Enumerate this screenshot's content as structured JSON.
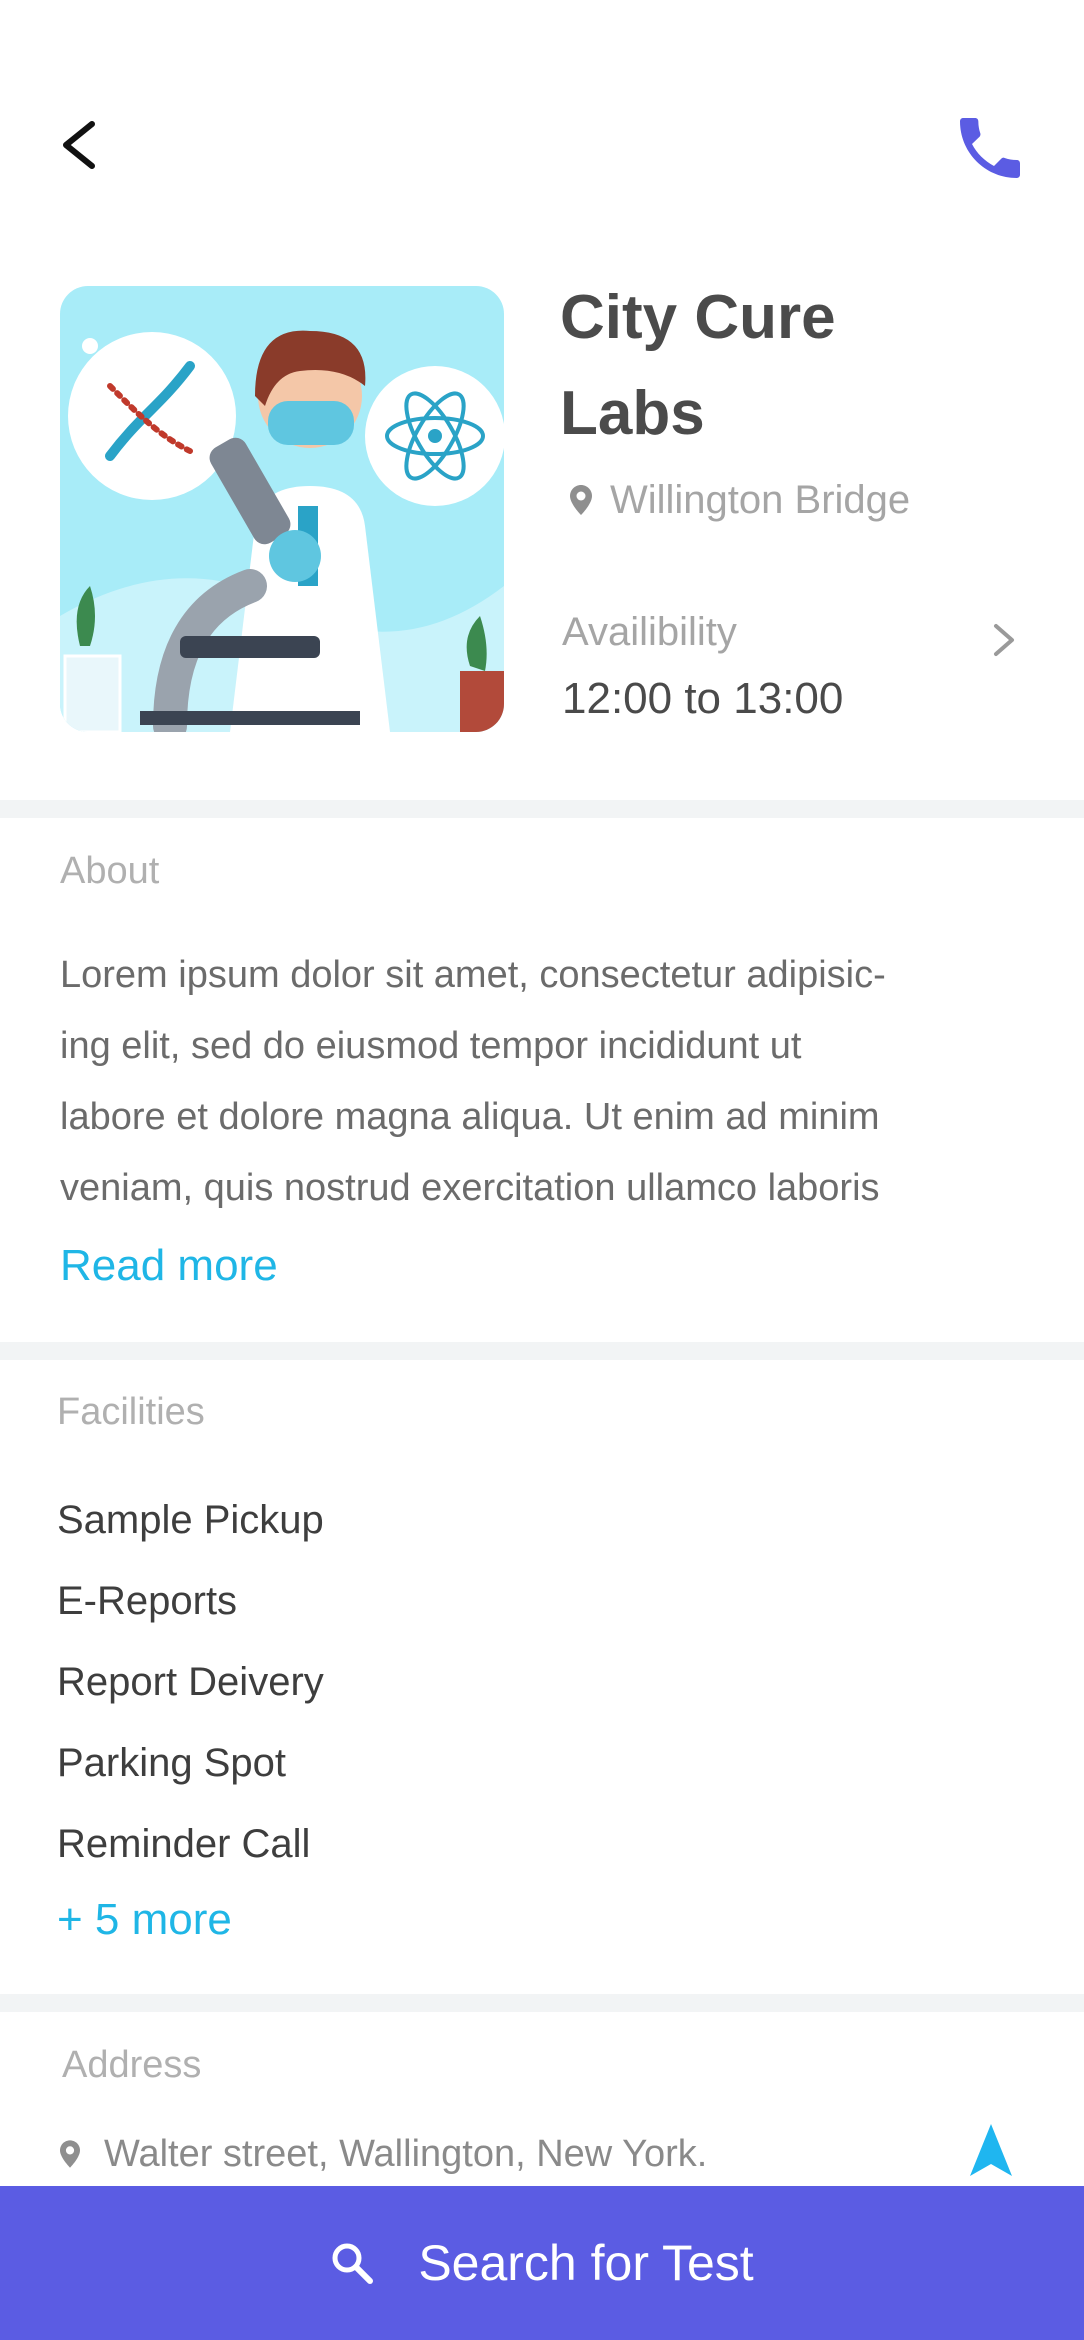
{
  "header": {
    "back_icon": "chevron-left-icon",
    "call_icon": "phone-icon"
  },
  "lab": {
    "name_line1": "City Cure",
    "name_line2": "Labs",
    "location": "Willington Bridge",
    "availability_label": "Availibility",
    "availability_time": "12:00 to 13:00",
    "image_icon": "scientist-microscope-illustration"
  },
  "about": {
    "label": "About",
    "lines": [
      "Lorem ipsum dolor sit amet, consectetur adipisic-",
      "ing elit, sed do eiusmod tempor incididunt ut",
      "labore et dolore magna aliqua. Ut enim ad minim",
      "veniam, quis nostrud exercitation ullamco laboris"
    ],
    "read_more": "Read more"
  },
  "facilities": {
    "label": "Facilities",
    "items": [
      "Sample Pickup",
      "E-Reports",
      "Report Deivery",
      "Parking Spot",
      "Reminder Call"
    ],
    "more": "+ 5 more"
  },
  "address": {
    "label": "Address",
    "text": "Walter street, Wallington, New York.",
    "nav_icon": "navigation-arrow-icon"
  },
  "cta": {
    "label": "Search for Test",
    "icon": "search-icon"
  },
  "colors": {
    "primary": "#5b5ce3",
    "link": "#1fb6e6",
    "nav_arrow": "#1fb6f0",
    "muted": "#a5a5a5",
    "divider": "#f2f4f5"
  }
}
